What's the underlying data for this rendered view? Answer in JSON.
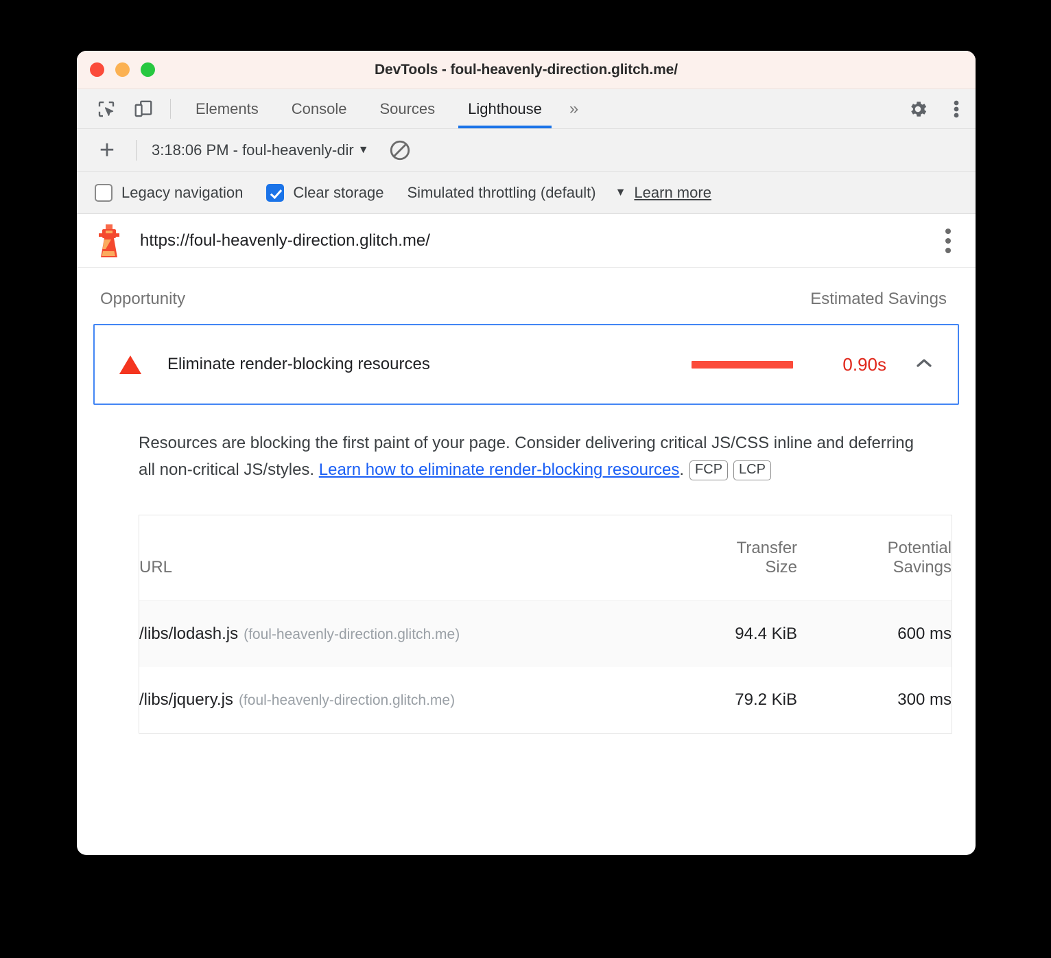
{
  "window": {
    "title": "DevTools - foul-heavenly-direction.glitch.me/",
    "traffic_lights": [
      "close",
      "minimize",
      "zoom"
    ],
    "colors": {
      "titlebar_bg": "#fcf1ed",
      "accent_blue": "#1a73e8",
      "warning_red": "#f4351f",
      "savings_bar": "#fb4b3a",
      "savings_text": "#e0261a"
    }
  },
  "tabbar": {
    "left_icons": [
      "inspect-element-icon",
      "device-toolbar-icon"
    ],
    "tabs": [
      {
        "label": "Elements",
        "active": false
      },
      {
        "label": "Console",
        "active": false
      },
      {
        "label": "Sources",
        "active": false
      },
      {
        "label": "Lighthouse",
        "active": true
      }
    ],
    "more_tabs": "»",
    "right_icons": [
      "settings-gear-icon",
      "more-options-kebab-icon"
    ]
  },
  "runbar": {
    "add_label": "+",
    "report_name": "3:18:06 PM - foul-heavenly-dir",
    "caret": "▼",
    "clear_icon": "clear-all-icon"
  },
  "options": {
    "legacy_navigation": {
      "label": "Legacy navigation",
      "checked": false
    },
    "clear_storage": {
      "label": "Clear storage",
      "checked": true
    },
    "throttling": {
      "label": "Simulated throttling (default)",
      "caret": "▼"
    },
    "learn_more": "Learn more"
  },
  "lighthouse": {
    "icon": "lighthouse-icon",
    "url": "https://foul-heavenly-direction.glitch.me/",
    "kebab": "report-options-kebab-icon"
  },
  "report": {
    "header": {
      "opportunity": "Opportunity",
      "estimated_savings": "Estimated Savings"
    },
    "opportunity": {
      "severity_icon": "warning-triangle-icon",
      "title": "Eliminate render-blocking resources",
      "savings_value": "0.90s",
      "savings_bar_fraction": 1.0,
      "expanded": true,
      "collapse_icon": "chevron-up-icon"
    },
    "description": {
      "text_before": "Resources are blocking the first paint of your page. Consider delivering critical JS/CSS inline and deferring all non-critical JS/styles. ",
      "link_text": "Learn how to eliminate render-blocking resources",
      "text_after": ".",
      "chips": [
        "FCP",
        "LCP"
      ]
    },
    "table": {
      "columns": [
        {
          "key": "url",
          "label": "URL"
        },
        {
          "key": "size",
          "label_line1": "Transfer",
          "label_line2": "Size"
        },
        {
          "key": "savings",
          "label_line1": "Potential",
          "label_line2": "Savings"
        }
      ],
      "rows": [
        {
          "path": "/libs/lodash.js",
          "host": "(foul-heavenly-direction.glitch.me)",
          "transfer_size": "94.4 KiB",
          "potential_savings": "600 ms"
        },
        {
          "path": "/libs/jquery.js",
          "host": "(foul-heavenly-direction.glitch.me)",
          "transfer_size": "79.2 KiB",
          "potential_savings": "300 ms"
        }
      ]
    }
  }
}
